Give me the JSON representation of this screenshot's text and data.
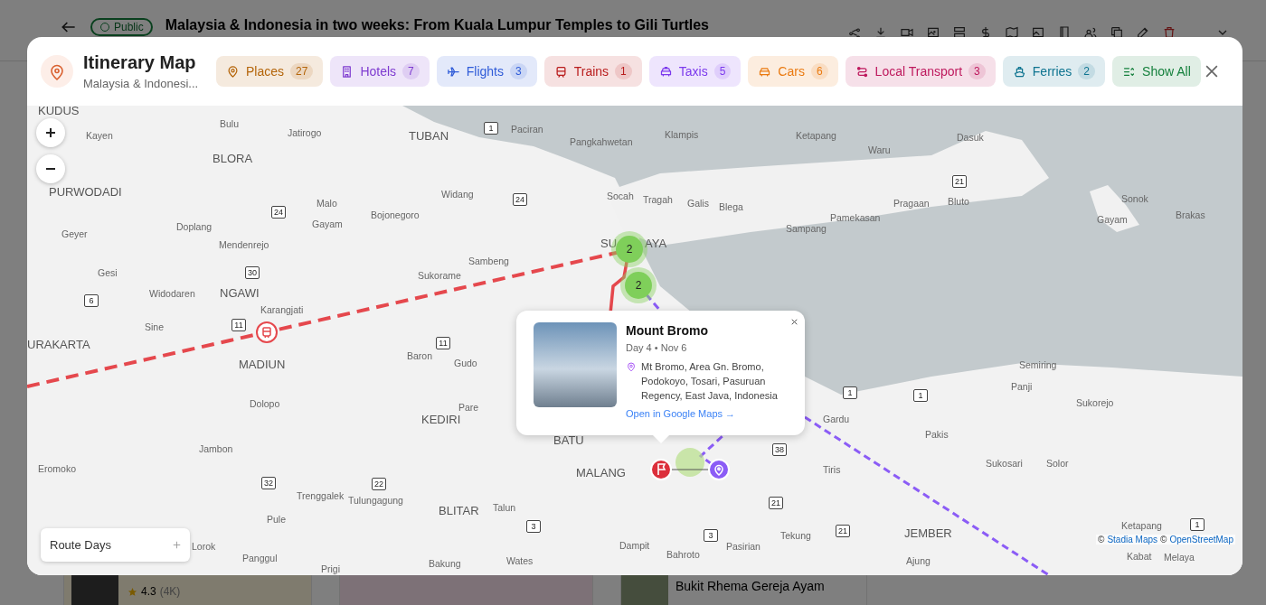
{
  "page": {
    "badge": "Public",
    "title": "Malaysia & Indonesia in two weeks: From Kuala Lumpur Temples to Gili Turtles",
    "cards": [
      {
        "rating": "4.3",
        "reviews": "(4K)"
      },
      {
        "title": "Bukit Rhema Gereja Ayam"
      }
    ]
  },
  "header": {
    "title": "Itinerary Map",
    "subtitle": "Malaysia & Indonesi..."
  },
  "filters": [
    {
      "kind": "places",
      "label": "Places",
      "count": "27",
      "color": "#b4650a"
    },
    {
      "kind": "hotels",
      "label": "Hotels",
      "count": "7",
      "color": "#7e3bd0"
    },
    {
      "kind": "flights",
      "label": "Flights",
      "count": "3",
      "color": "#2f5bd8"
    },
    {
      "kind": "trains",
      "label": "Trains",
      "count": "1",
      "color": "#b91c1c"
    },
    {
      "kind": "taxis",
      "label": "Taxis",
      "count": "5",
      "color": "#7c3aed"
    },
    {
      "kind": "cars",
      "label": "Cars",
      "count": "6",
      "color": "#ea7a10"
    },
    {
      "kind": "local",
      "label": "Local Transport",
      "count": "3",
      "color": "#be185d"
    },
    {
      "kind": "ferries",
      "label": "Ferries",
      "count": "2",
      "color": "#0e7490"
    },
    {
      "kind": "all",
      "label": "Show All",
      "color": "#15803d"
    }
  ],
  "map": {
    "labels": [
      {
        "text": "KUDUS",
        "kind": "city"
      },
      {
        "text": "Kayen",
        "kind": "town"
      },
      {
        "text": "Bulu",
        "kind": "town"
      },
      {
        "text": "Jatirogo",
        "kind": "town"
      },
      {
        "text": "TUBAN",
        "kind": "city"
      },
      {
        "text": "Paciran",
        "kind": "town"
      },
      {
        "text": "Pangkahwetan",
        "kind": "town"
      },
      {
        "text": "Klampis",
        "kind": "town"
      },
      {
        "text": "Ketapang",
        "kind": "town"
      },
      {
        "text": "Dasuk",
        "kind": "town"
      },
      {
        "text": "BLORA",
        "kind": "city"
      },
      {
        "text": "Waru",
        "kind": "town"
      },
      {
        "text": "PURWODADI",
        "kind": "city"
      },
      {
        "text": "Geyer",
        "kind": "town"
      },
      {
        "text": "Doplang",
        "kind": "town"
      },
      {
        "text": "Mendenrejo",
        "kind": "town"
      },
      {
        "text": "Malo",
        "kind": "town"
      },
      {
        "text": "Gayam",
        "kind": "town"
      },
      {
        "text": "Bojonegoro",
        "kind": "town"
      },
      {
        "text": "Widang",
        "kind": "town"
      },
      {
        "text": "Socah",
        "kind": "town"
      },
      {
        "text": "SU",
        "kind": "city"
      },
      {
        "text": "Tragah",
        "kind": "town"
      },
      {
        "text": "AYA",
        "kind": "city"
      },
      {
        "text": "Galis",
        "kind": "town"
      },
      {
        "text": "Blega",
        "kind": "town"
      },
      {
        "text": "Sampang",
        "kind": "town"
      },
      {
        "text": "Pamekasan",
        "kind": "town"
      },
      {
        "text": "Pragaan",
        "kind": "town"
      },
      {
        "text": "Bluto",
        "kind": "town"
      },
      {
        "text": "Gayam",
        "kind": "town"
      },
      {
        "text": "Sonok",
        "kind": "town"
      },
      {
        "text": "Brakas",
        "kind": "town"
      },
      {
        "text": "Sambeng",
        "kind": "town"
      },
      {
        "text": "Gesi",
        "kind": "town"
      },
      {
        "text": "Sukorame",
        "kind": "town"
      },
      {
        "text": "Widodaren",
        "kind": "town"
      },
      {
        "text": "NGAWI",
        "kind": "city"
      },
      {
        "text": "Karangjati",
        "kind": "town"
      },
      {
        "text": "Sine",
        "kind": "town"
      },
      {
        "text": "URAKARTA",
        "kind": "city"
      },
      {
        "text": "MADIUN",
        "kind": "city"
      },
      {
        "text": "Baron",
        "kind": "town"
      },
      {
        "text": "Gudo",
        "kind": "town"
      },
      {
        "text": "Semiring",
        "kind": "town"
      },
      {
        "text": "Panji",
        "kind": "town"
      },
      {
        "text": "Dolopo",
        "kind": "town"
      },
      {
        "text": "Pare",
        "kind": "town"
      },
      {
        "text": "Sukorejo",
        "kind": "town"
      },
      {
        "text": "KEDIRI",
        "kind": "city"
      },
      {
        "text": "Gardu",
        "kind": "town"
      },
      {
        "text": "Jambon",
        "kind": "town"
      },
      {
        "text": "BATU",
        "kind": "city"
      },
      {
        "text": "Pakis",
        "kind": "town"
      },
      {
        "text": "Eromoko",
        "kind": "town"
      },
      {
        "text": "MALANG",
        "kind": "city"
      },
      {
        "text": "Tiris",
        "kind": "town"
      },
      {
        "text": "Sukosari",
        "kind": "town"
      },
      {
        "text": "Solor",
        "kind": "town"
      },
      {
        "text": "Pule",
        "kind": "town"
      },
      {
        "text": "Trenggalek",
        "kind": "town"
      },
      {
        "text": "Tulungagung",
        "kind": "town"
      },
      {
        "text": "BLITAR",
        "kind": "city"
      },
      {
        "text": "Talun",
        "kind": "town"
      },
      {
        "text": "Lorok",
        "kind": "town"
      },
      {
        "text": "Panggul",
        "kind": "town"
      },
      {
        "text": "Prigi",
        "kind": "town"
      },
      {
        "text": "Bakung",
        "kind": "town"
      },
      {
        "text": "Wates",
        "kind": "town"
      },
      {
        "text": "Dampit",
        "kind": "town"
      },
      {
        "text": "Bahroto",
        "kind": "town"
      },
      {
        "text": "Pasirian",
        "kind": "town"
      },
      {
        "text": "Tekung",
        "kind": "town"
      },
      {
        "text": "JEMBER",
        "kind": "city"
      },
      {
        "text": "Ajung",
        "kind": "town"
      },
      {
        "text": "Ketapang",
        "kind": "town"
      },
      {
        "text": "Kabat",
        "kind": "town"
      },
      {
        "text": "Melaya",
        "kind": "town"
      }
    ],
    "road_signs": [
      "24",
      "24",
      "30",
      "11",
      "11",
      "1",
      "21",
      "38",
      "32",
      "22",
      "3",
      "3",
      "21",
      "21",
      "1",
      "1",
      "1",
      "6"
    ],
    "markers": [
      {
        "kind": "train"
      },
      {
        "kind": "cluster",
        "count": "2"
      },
      {
        "kind": "cluster",
        "count": "2"
      },
      {
        "kind": "flag"
      },
      {
        "kind": "pin"
      }
    ],
    "popup": {
      "title": "Mount Bromo",
      "date": "Day 4 • Nov 6",
      "address": "Mt Bromo, Area Gn. Bromo, Podokoyo, Tosari, Pasuruan Regency, East Java, Indonesia",
      "link": "Open in Google Maps →"
    },
    "route_days": {
      "label": "Route Days"
    },
    "attribution": [
      {
        "kind": "sep",
        "text": "©"
      },
      {
        "kind": "link",
        "text": "Stadia Maps"
      },
      {
        "kind": "sep",
        "text": "©"
      },
      {
        "kind": "link",
        "text": "OpenStreetMap"
      }
    ]
  }
}
